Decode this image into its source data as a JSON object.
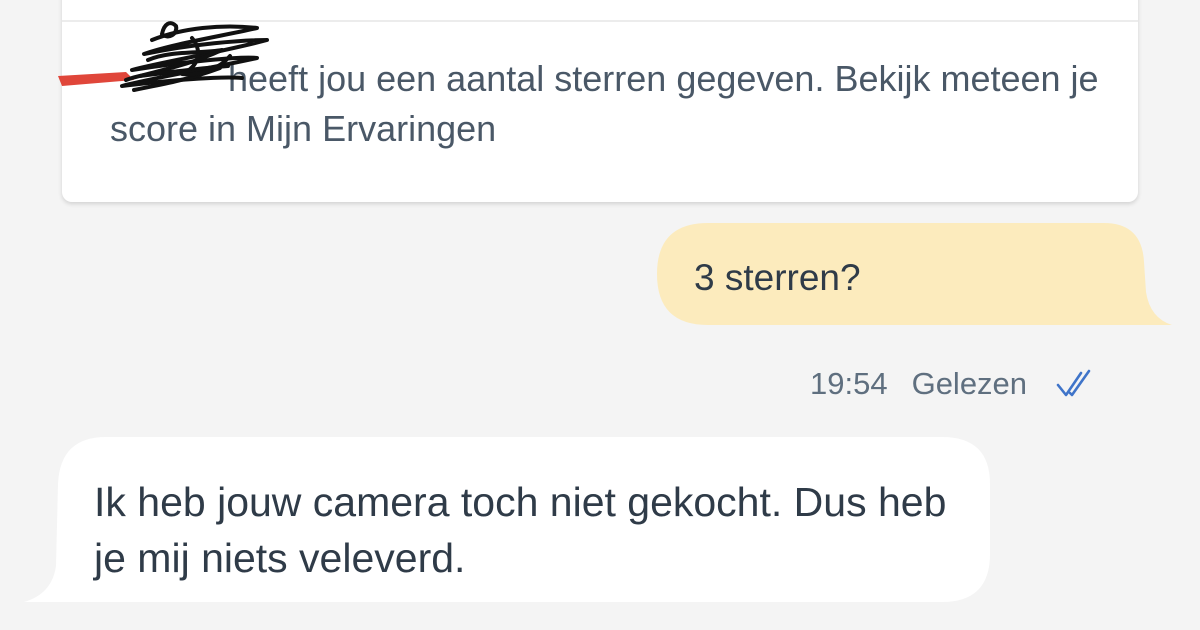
{
  "notice": {
    "sender_redacted": "scribbled-out name",
    "message_suffix": "heeft jou een aantal sterren gegeven. Bekijk meteen je score in Mijn Ervaringen"
  },
  "messages": {
    "outgoing": {
      "text": "3 sterren?",
      "time": "19:54",
      "status": "Gelezen",
      "status_icon": "double-check-icon"
    },
    "incoming": {
      "text": "Ik heb jouw camera toch niet gekocht. Dus heb je mij niets veleverd."
    }
  },
  "colors": {
    "background": "#f4f4f4",
    "card": "#ffffff",
    "outgoing_bubble": "#fcebbd",
    "incoming_bubble": "#ffffff",
    "text": "#2f3b48",
    "meta_text": "#5f6f7f",
    "read_check": "#3f74c9",
    "redaction_ink": "#111111",
    "redaction_red": "#e0463a"
  }
}
